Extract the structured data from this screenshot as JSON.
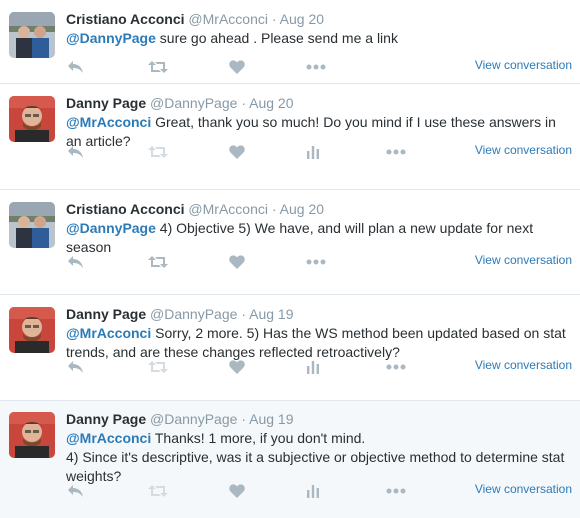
{
  "tweets": [
    {
      "fullname": "Cristiano Acconci",
      "username": "@MrAcconci",
      "separator": "·",
      "time": "Aug 20",
      "mention": "@DannyPage",
      "text": " sure go ahead . Please send me a link",
      "view": "View conversation",
      "has_analytics": false
    },
    {
      "fullname": "Danny Page",
      "username": "@DannyPage",
      "separator": "·",
      "time": "Aug 20",
      "mention": "@MrAcconci",
      "text": " Great, thank you so much! Do you mind if I use these answers in an article?",
      "view": "View conversation",
      "has_analytics": true
    },
    {
      "fullname": "Cristiano Acconci",
      "username": "@MrAcconci",
      "separator": "·",
      "time": "Aug 20",
      "mention": "@DannyPage",
      "text": " 4) Objective 5) We have, and will plan a new update for next season",
      "view": "View conversation",
      "has_analytics": false
    },
    {
      "fullname": "Danny Page",
      "username": "@DannyPage",
      "separator": "·",
      "time": "Aug 19",
      "mention": "@MrAcconci",
      "text": " Sorry, 2 more. 5) Has the WS method been updated based on stat trends, and are these changes reflected retroactively?",
      "view": "View conversation",
      "has_analytics": true
    },
    {
      "fullname": "Danny Page",
      "username": "@DannyPage",
      "separator": "·",
      "time": "Aug 19",
      "mention": "@MrAcconci",
      "text": " Thanks! 1 more, if you don't mind.",
      "text2": "4) Since it's descriptive, was it a subjective or objective method to determine stat weights?",
      "view": "View conversation",
      "has_analytics": true
    }
  ],
  "icons": {
    "reply": "reply-icon",
    "retweet": "retweet-icon",
    "like": "heart-icon",
    "analytics": "analytics-icon",
    "more": "more-icon"
  },
  "colors": {
    "link": "#2b7bb9",
    "meta": "#8899a6",
    "icon": "#aab8c2",
    "divider": "#e1e8ed",
    "highlight_bg": "#f5f8fa"
  }
}
